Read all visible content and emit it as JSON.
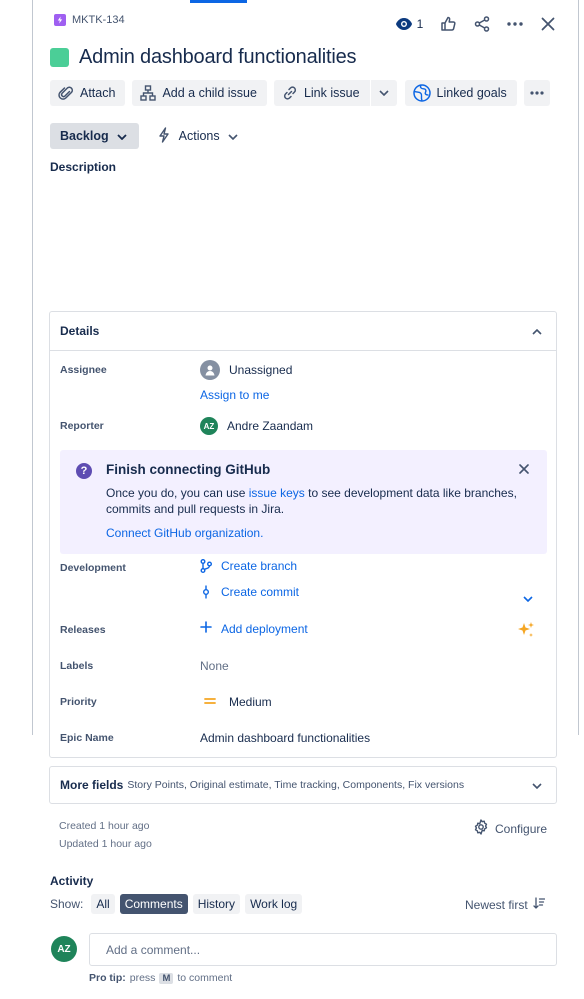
{
  "issue": {
    "key": "MKTK-134",
    "title": "Admin dashboard functionalities",
    "watch_count": "1"
  },
  "toolbar": {
    "attach": "Attach",
    "add_child": "Add a child issue",
    "link_issue": "Link issue",
    "linked_goals": "Linked goals"
  },
  "status": {
    "value": "Backlog",
    "actions": "Actions"
  },
  "description": {
    "label": "Description"
  },
  "details": {
    "heading": "Details",
    "assignee_label": "Assignee",
    "assignee_value": "Unassigned",
    "assign_to_me": "Assign to me",
    "reporter_label": "Reporter",
    "reporter_initials": "AZ",
    "reporter_name": "Andre Zaandam",
    "github_banner": {
      "title": "Finish connecting GitHub",
      "body_prefix": "Once you do, you can use ",
      "body_link": "issue keys",
      "body_suffix": " to see development data like branches, commits and pull requests in Jira.",
      "cta": "Connect GitHub organization."
    },
    "development_label": "Development",
    "create_branch": "Create branch",
    "create_commit": "Create commit",
    "releases_label": "Releases",
    "add_deployment": "Add deployment",
    "labels_label": "Labels",
    "labels_value": "None",
    "priority_label": "Priority",
    "priority_value": "Medium",
    "epic_name_label": "Epic Name",
    "epic_name_value": "Admin dashboard functionalities"
  },
  "more_fields": {
    "title": "More fields",
    "subtitle": "Story Points, Original estimate, Time tracking, Components, Fix versions"
  },
  "meta": {
    "created": "Created 1 hour ago",
    "updated": "Updated 1 hour ago",
    "configure": "Configure"
  },
  "activity": {
    "title": "Activity",
    "show_label": "Show:",
    "filters": [
      "All",
      "Comments",
      "History",
      "Work log"
    ],
    "active_filter": "Comments",
    "sort": "Newest first",
    "user_initials": "AZ",
    "comment_placeholder": "Add a comment...",
    "pro_tip_label": "Pro tip:",
    "pro_tip_press": "press",
    "pro_tip_key": "M",
    "pro_tip_suffix": "to comment"
  },
  "colors": {
    "accent": "#0c66e4",
    "epic": "#9f5ff1",
    "status_square": "#4bce97",
    "avatar": "#1f845a",
    "banner": "#f3f0ff",
    "priority_medium": "#f5a623"
  }
}
